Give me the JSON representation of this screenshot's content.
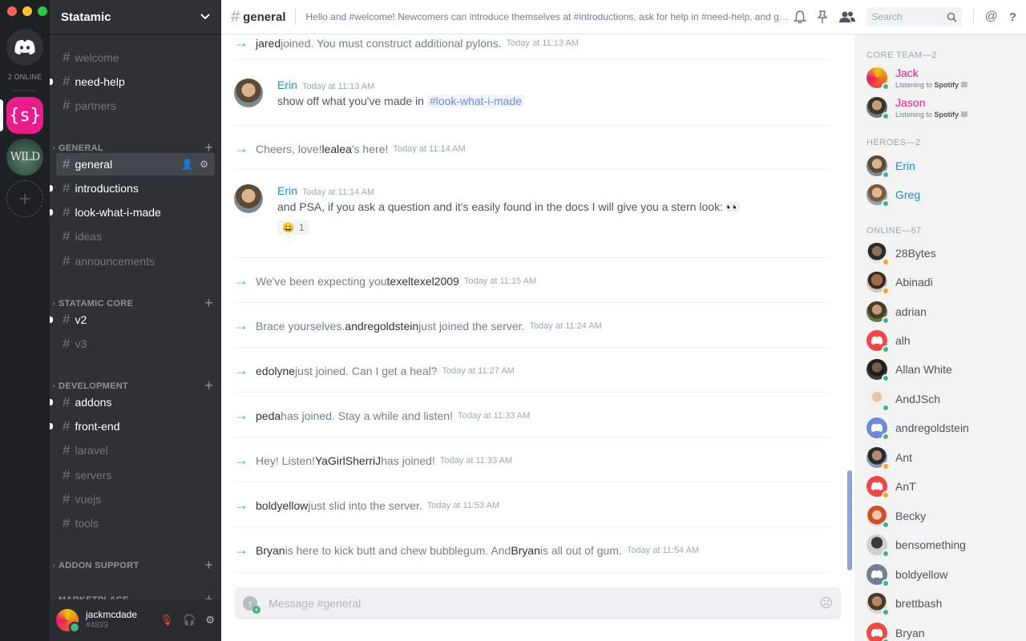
{
  "rail": {
    "online_count": "2 ONLINE",
    "statamic_glyph": "{s}",
    "wild_glyph": "WILD",
    "add_glyph": "+"
  },
  "guild": {
    "name": "Statamic"
  },
  "channels": {
    "top": [
      {
        "name": "welcome",
        "unread": false
      },
      {
        "name": "need-help",
        "unread": true
      },
      {
        "name": "partners",
        "unread": false
      }
    ],
    "categories": [
      {
        "name": "GENERAL",
        "channels": [
          {
            "name": "general",
            "active": true
          },
          {
            "name": "introductions",
            "unread": true
          },
          {
            "name": "look-what-i-made",
            "unread": true
          },
          {
            "name": "ideas"
          },
          {
            "name": "announcements"
          }
        ]
      },
      {
        "name": "STATAMIC CORE",
        "channels": [
          {
            "name": "v2",
            "unread": true
          },
          {
            "name": "v3"
          }
        ]
      },
      {
        "name": "DEVELOPMENT",
        "channels": [
          {
            "name": "addons",
            "unread": true
          },
          {
            "name": "front-end",
            "unread": true
          },
          {
            "name": "laravel"
          },
          {
            "name": "servers"
          },
          {
            "name": "vuejs"
          },
          {
            "name": "tools"
          }
        ]
      },
      {
        "name": "ADDON SUPPORT",
        "channels": []
      },
      {
        "name": "MARKETPLACE",
        "channels": []
      }
    ]
  },
  "user": {
    "name": "jackmcdade",
    "tag": "#4833"
  },
  "header": {
    "channel": "general",
    "topic": "Hello and #welcome! Newcomers can introduce themselves at #introductions, ask for help in #need-help, and ge...",
    "search_placeholder": "Search"
  },
  "messages": {
    "j1": {
      "pre": "",
      "user": "jared",
      "post": " joined. You must construct additional pylons.",
      "ts": "Today at 11:13 AM"
    },
    "m1": {
      "author": "Erin",
      "ts": "Today at 11:13 AM",
      "text": "show off what you've made in ",
      "mention": "#look-what-i-made"
    },
    "j2": {
      "pre": "Cheers, love! ",
      "user": "lealea",
      "post": "'s here!",
      "ts": "Today at 11:14 AM"
    },
    "m2": {
      "author": "Erin",
      "ts": "Today at 11:14 AM",
      "text": "and PSA, if you ask a question and it's easily found in the docs I will give you a stern look: 👀",
      "reaction_emoji": "😀",
      "reaction_count": "1"
    },
    "j3": {
      "pre": "We've been expecting you ",
      "user": "texeltexel2009",
      "post": "",
      "ts": "Today at 11:15 AM"
    },
    "j4": {
      "pre": "Brace yourselves. ",
      "user": "andregoldstein",
      "post": " just joined the server.",
      "ts": "Today at 11:24 AM"
    },
    "j5": {
      "pre": "",
      "user": "edolyne",
      "post": " just joined. Can I get a heal?",
      "ts": "Today at 11:27 AM"
    },
    "j6": {
      "pre": "",
      "user": "peda",
      "post": " has joined. Stay a while and listen!",
      "ts": "Today at 11:33 AM"
    },
    "j7": {
      "pre": "Hey! Listen! ",
      "user": "YaGirlSherriJ",
      "post": " has joined!",
      "ts": "Today at 11:33 AM"
    },
    "j8": {
      "pre": "",
      "user": "boldyellow",
      "post": " just slid into the server.",
      "ts": "Today at 11:53 AM"
    },
    "j9": {
      "pre": "",
      "user": "Bryan",
      "post": " is here to kick butt and chew bubblegum. And ",
      "user2": "Bryan",
      "post2": " is all out of gum.",
      "ts": "Today at 11:54 AM"
    }
  },
  "composer": {
    "placeholder": "Message #general"
  },
  "members": {
    "core_team": "CORE TEAM—2",
    "heroes": "HEROES—2",
    "online": "ONLINE—67",
    "core": [
      {
        "name": "Jack",
        "activity_pre": "Listening to ",
        "activity_app": "Spotify"
      },
      {
        "name": "Jason",
        "activity_pre": "Listening to ",
        "activity_app": "Spotify"
      }
    ],
    "hero_list": [
      "Erin",
      "Greg"
    ],
    "online_list": [
      "28Bytes",
      "Abinadi",
      "adrian",
      "alh",
      "Allan White",
      "AndJSch",
      "andregoldstein",
      "Ant",
      "AnT",
      "Becky",
      "bensomething",
      "boldyellow",
      "brettbash",
      "Bryan"
    ]
  },
  "colors": {
    "accent": "#7289da",
    "online": "#43b581",
    "idle": "#faa61a",
    "core_team": "#e91e8c",
    "hero": "#1f8fca"
  }
}
